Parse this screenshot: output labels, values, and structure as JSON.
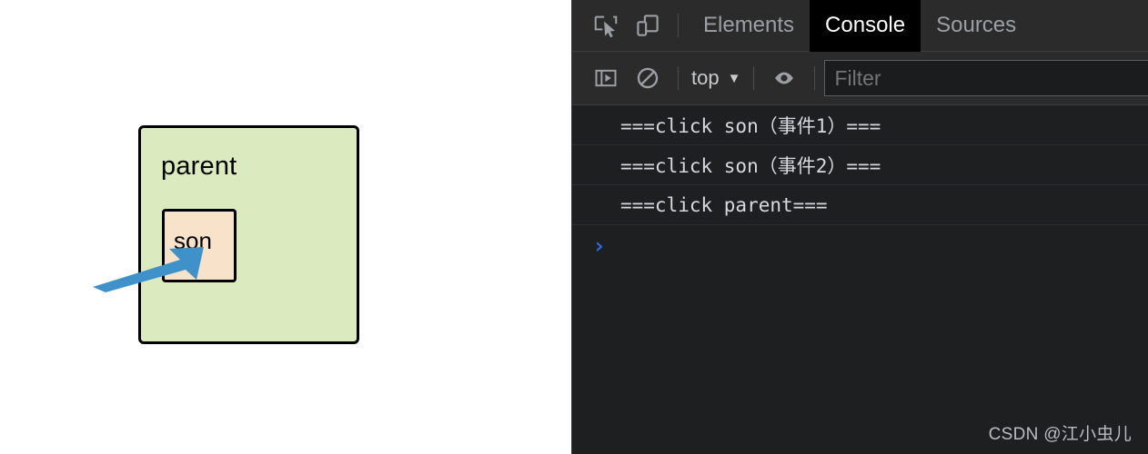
{
  "page": {
    "parent_box": {
      "label": "parent",
      "bg_color": "#dceac0",
      "border_color": "#000000"
    },
    "son_box": {
      "label": "son",
      "bg_color": "#f8e2ca",
      "border_color": "#000000"
    },
    "arrow": {
      "name": "blue-pointer-arrow",
      "color": "#3e92c9"
    }
  },
  "devtools": {
    "tabbar": {
      "icons": [
        {
          "name": "inspect-element-icon"
        },
        {
          "name": "device-toolbar-icon"
        }
      ],
      "tabs": [
        {
          "label": "Elements",
          "active": false
        },
        {
          "label": "Console",
          "active": true
        },
        {
          "label": "Sources",
          "active": false
        }
      ]
    },
    "console_toolbar": {
      "sidebar_toggle": {
        "name": "console-sidebar-icon"
      },
      "clear_console": {
        "name": "clear-console-icon"
      },
      "context": {
        "label": "top",
        "caret": "▼"
      },
      "eye": {
        "name": "live-expression-eye-icon"
      },
      "filter": {
        "placeholder": "Filter",
        "value": ""
      }
    },
    "messages": [
      "===click son（事件1）===",
      "===click son（事件2）===",
      "===click parent==="
    ],
    "prompt": {
      "chevron": "›",
      "value": ""
    },
    "watermark": "CSDN @江小虫儿"
  }
}
